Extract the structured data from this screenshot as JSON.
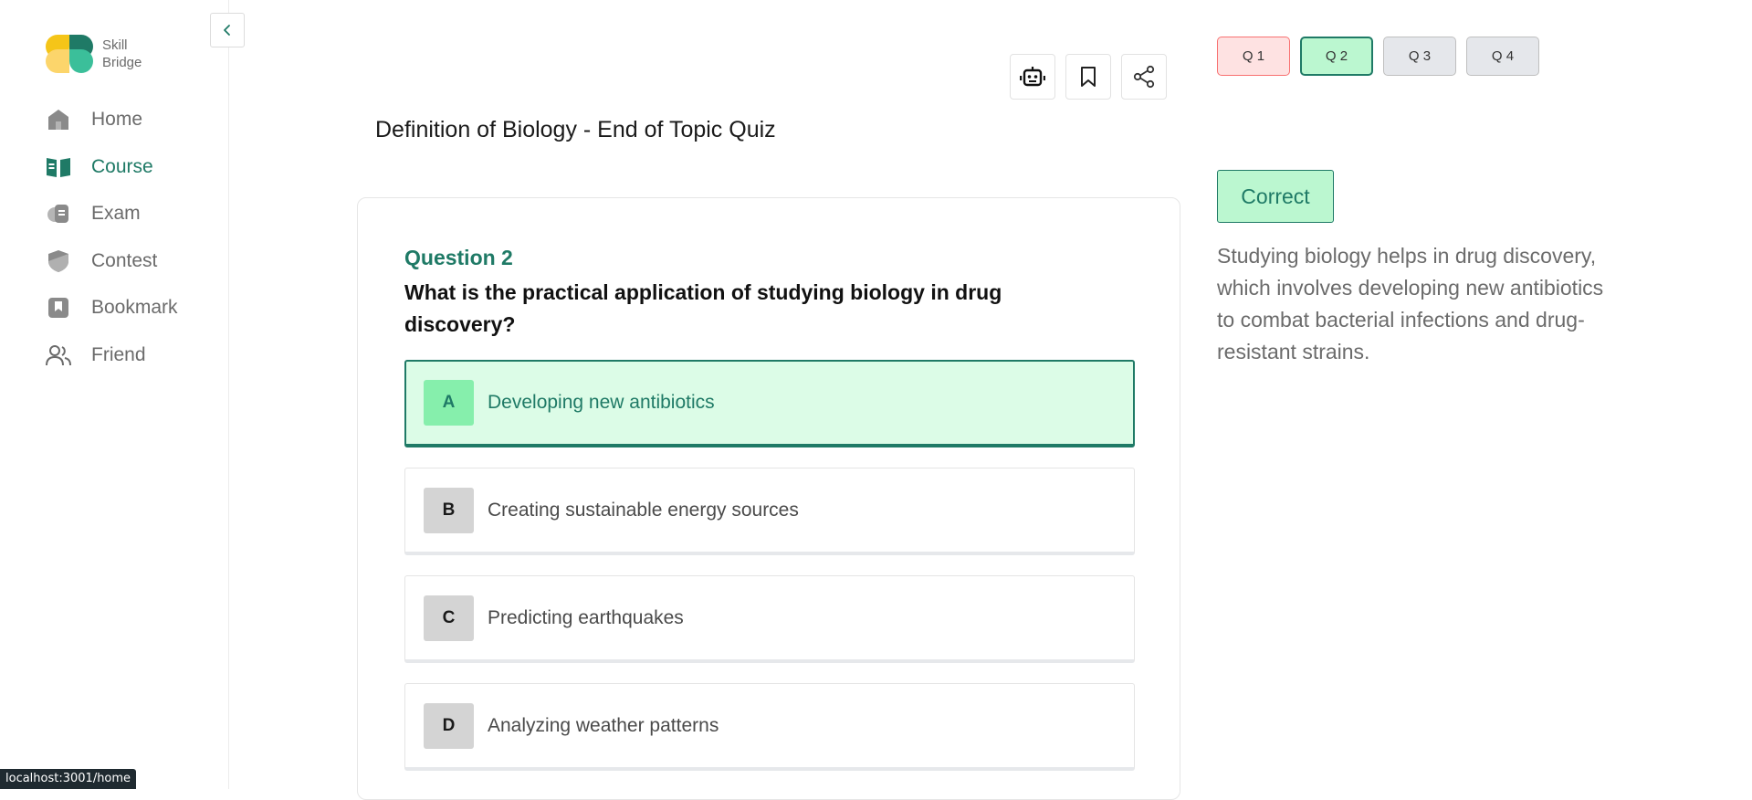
{
  "brand": {
    "line1": "Skill",
    "line2": "Bridge"
  },
  "sidebar": {
    "items": [
      {
        "label": "Home",
        "icon": "home-icon"
      },
      {
        "label": "Course",
        "icon": "book-icon",
        "active": true
      },
      {
        "label": "Exam",
        "icon": "exam-icon"
      },
      {
        "label": "Contest",
        "icon": "shield-icon"
      },
      {
        "label": "Bookmark",
        "icon": "bookmark-icon"
      },
      {
        "label": "Friend",
        "icon": "users-icon"
      }
    ]
  },
  "toolbar": {
    "icons": [
      "robot-icon",
      "bookmark-icon",
      "share-icon"
    ]
  },
  "quiz": {
    "title": "Definition of Biology - End of Topic Quiz",
    "question_number": "Question 2",
    "question_text": "What is the practical application of studying biology in drug discovery?",
    "options": [
      {
        "letter": "A",
        "text": "Developing new antibiotics",
        "selected": true
      },
      {
        "letter": "B",
        "text": "Creating sustainable energy sources"
      },
      {
        "letter": "C",
        "text": "Predicting earthquakes"
      },
      {
        "letter": "D",
        "text": "Analyzing weather patterns"
      }
    ]
  },
  "question_nav": [
    {
      "label": "Q 1",
      "state": "wrong"
    },
    {
      "label": "Q 2",
      "state": "current"
    },
    {
      "label": "Q 3",
      "state": "unanswered"
    },
    {
      "label": "Q 4",
      "state": "unanswered"
    }
  ],
  "result": {
    "status": "Correct",
    "explanation": "Studying biology helps in drug discovery, which involves developing new antibiotics to combat bacterial infections and drug-resistant strains."
  },
  "status_bar": {
    "url": "localhost:3001/home"
  },
  "colors": {
    "accent": "#1f7a66",
    "correct_bg": "#dcfce7",
    "wrong_bg": "#fee2e2",
    "muted": "#6b6b6b"
  }
}
